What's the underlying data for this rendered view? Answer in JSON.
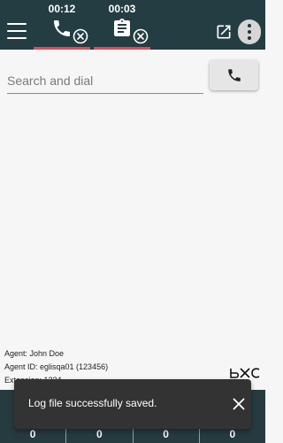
{
  "header": {
    "tabs": [
      {
        "timer": "00:12",
        "icon": "phone-icon"
      },
      {
        "timer": "00:03",
        "icon": "clipboard-icon"
      }
    ],
    "tab_close_icon": "close-circle-icon",
    "menu_icon": "hamburger-icon",
    "popout_icon": "open-in-new-icon",
    "more_icon": "more-vertical-icon",
    "colors": {
      "bar": "#243d43",
      "active_tab_underline": "#e04a55"
    }
  },
  "search": {
    "placeholder": "Search and dial",
    "value": "",
    "dial_icon": "phone-icon"
  },
  "agent": {
    "name_line": "Agent: John Doe",
    "id_line": "Agent ID: eglisqa01 (123456)",
    "extension_line": "Extension: 1234"
  },
  "stats": [
    "0",
    "0",
    "0",
    "0"
  ],
  "snackbar": {
    "message": "Log file successfully saved.",
    "close_icon": "close-icon"
  }
}
